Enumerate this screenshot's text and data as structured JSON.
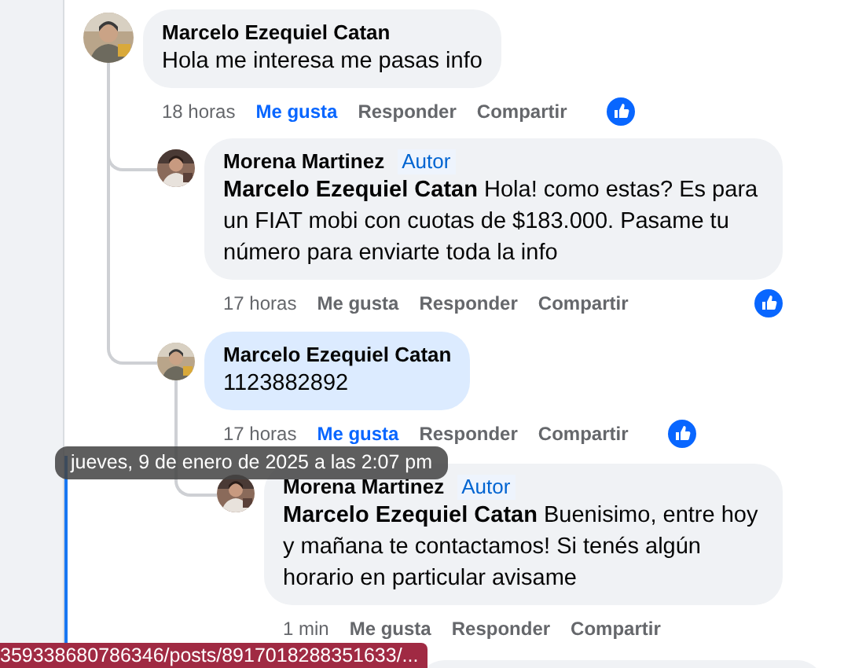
{
  "comments": [
    {
      "author": "Marcelo Ezequiel Catan",
      "text": "Hola me interesa me pasas info",
      "highlighted": false,
      "time": "18 horas",
      "like_label": "Me gusta",
      "liked": true,
      "reply_label": "Responder",
      "share_label": "Compartir",
      "reacted": true,
      "children": [
        {
          "author": "Morena Martinez",
          "badge": "Autor",
          "text": "**Marcelo Ezequiel Catan** Hola! como estas? Es para un FIAT mobi con cuotas de $183.000. Pasame tu número para enviarte toda la info",
          "highlighted": false,
          "time": "17 horas",
          "like_label": "Me gusta",
          "liked": false,
          "reply_label": "Responder",
          "share_label": "Compartir",
          "reacted": true
        },
        {
          "author": "Marcelo Ezequiel Catan",
          "text": "1123882892",
          "highlighted": true,
          "time": "17 horas",
          "like_label": "Me gusta",
          "liked": true,
          "reply_label": "Responder",
          "share_label": "Compartir",
          "reacted": true,
          "children": [
            {
              "author": "Morena Martinez",
              "badge": "Autor",
              "text": "**Marcelo Ezequiel Catan** Buenisimo, entre hoy y mañana te contactamos! Si tenés algún horario en particular avisame",
              "highlighted": false,
              "time": "1 min",
              "like_label": "Me gusta",
              "liked": false,
              "reply_label": "Responder",
              "share_label": "Compartir",
              "reacted": false
            }
          ]
        }
      ]
    }
  ],
  "tooltip": {
    "text": "jueves, 9 de enero de 2025 a las 2:07 pm"
  },
  "status_bar": {
    "url": "359338680786346/posts/8917018288351633/..."
  }
}
